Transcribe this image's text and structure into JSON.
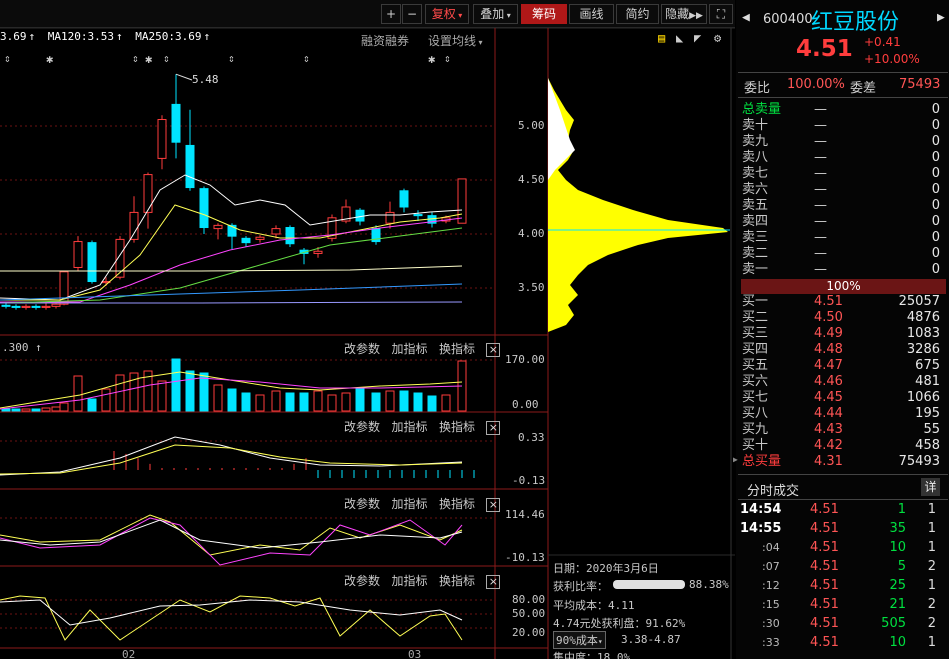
{
  "toolbar": {
    "plus": "+",
    "minus": "−",
    "restore": "复权",
    "overlay": "叠加",
    "chips": "筹码",
    "draw": "画线",
    "simple": "简约",
    "hide": "隐藏",
    "expand": "⛶"
  },
  "ma_line": {
    "ma_a": "3.69",
    "ma120": "MA120:3.53",
    "ma250": "MA250:3.69",
    "margin": "融资融券",
    "set_ma": "设置均线"
  },
  "price_axis": [
    "5.00",
    "4.50",
    "4.00",
    "3.50"
  ],
  "peak_label": "5.48",
  "volume_axis": [
    "170.00",
    "0.00"
  ],
  "volume_label": ".300",
  "macd_axis": [
    "0.33",
    "-0.13"
  ],
  "kdj_axis": [
    "114.46",
    "-10.13"
  ],
  "rsi_axis": [
    "80.00",
    "50.00",
    "20.00"
  ],
  "indicator_tools": {
    "params": "改参数",
    "add": "加指标",
    "switch": "换指标",
    "close": "×"
  },
  "date_labels": [
    "02",
    "03"
  ],
  "chip_info": {
    "date": "日期：2020年3月6日",
    "profit_label": "获利比率：",
    "profit_value": "88.38%",
    "avg_cost": "平均成本：4.11",
    "profit_at": "4.74元处获利盘：91.62%",
    "cost_select": "90%成本",
    "cost_range": "3.38-4.87",
    "concentration": "集中度：18.0%"
  },
  "stock": {
    "code": "600400",
    "name": "红豆股份",
    "price": "4.51",
    "change": "+0.41",
    "change_pct": "+10.00%"
  },
  "weibi": {
    "label": "委比",
    "value": "100.00%",
    "diff_label": "委差",
    "diff_value": "75493"
  },
  "sell": {
    "total_label": "总卖量",
    "total_value": "0",
    "rows": [
      {
        "label": "卖十",
        "price": "—",
        "vol": "0"
      },
      {
        "label": "卖九",
        "price": "—",
        "vol": "0"
      },
      {
        "label": "卖八",
        "price": "—",
        "vol": "0"
      },
      {
        "label": "卖七",
        "price": "—",
        "vol": "0"
      },
      {
        "label": "卖六",
        "price": "—",
        "vol": "0"
      },
      {
        "label": "卖五",
        "price": "—",
        "vol": "0"
      },
      {
        "label": "卖四",
        "price": "—",
        "vol": "0"
      },
      {
        "label": "卖三",
        "price": "—",
        "vol": "0"
      },
      {
        "label": "卖二",
        "price": "—",
        "vol": "0"
      },
      {
        "label": "卖一",
        "price": "—",
        "vol": "0"
      }
    ]
  },
  "ratio_bar": "100%",
  "buy": {
    "rows": [
      {
        "label": "买一",
        "price": "4.51",
        "vol": "25057"
      },
      {
        "label": "买二",
        "price": "4.50",
        "vol": "4876"
      },
      {
        "label": "买三",
        "price": "4.49",
        "vol": "1083"
      },
      {
        "label": "买四",
        "price": "4.48",
        "vol": "3286"
      },
      {
        "label": "买五",
        "price": "4.47",
        "vol": "675"
      },
      {
        "label": "买六",
        "price": "4.46",
        "vol": "481"
      },
      {
        "label": "买七",
        "price": "4.45",
        "vol": "1066"
      },
      {
        "label": "买八",
        "price": "4.44",
        "vol": "195"
      },
      {
        "label": "买九",
        "price": "4.43",
        "vol": "55"
      },
      {
        "label": "买十",
        "price": "4.42",
        "vol": "458"
      }
    ],
    "total_label": "总买量",
    "total_price": "4.31",
    "total_value": "75493"
  },
  "ticks": {
    "title": "分时成交",
    "detail": "详",
    "rows": [
      {
        "time": "14:54",
        "price": "4.51",
        "vol": "1",
        "n": "1"
      },
      {
        "time": "14:55",
        "price": "4.51",
        "vol": "35",
        "n": "1"
      },
      {
        "time": ":04",
        "price": "4.51",
        "vol": "10",
        "n": "1"
      },
      {
        "time": ":07",
        "price": "4.51",
        "vol": "5",
        "n": "2"
      },
      {
        "time": ":12",
        "price": "4.51",
        "vol": "25",
        "n": "1"
      },
      {
        "time": ":15",
        "price": "4.51",
        "vol": "21",
        "n": "2"
      },
      {
        "time": ":30",
        "price": "4.51",
        "vol": "505",
        "n": "2"
      },
      {
        "time": ":33",
        "price": "4.51",
        "vol": "10",
        "n": "1"
      }
    ]
  },
  "colors": {
    "up": "#ff3d3d",
    "down": "#00e5ff",
    "chip": "#ffff00",
    "accent": "#ffd700"
  }
}
